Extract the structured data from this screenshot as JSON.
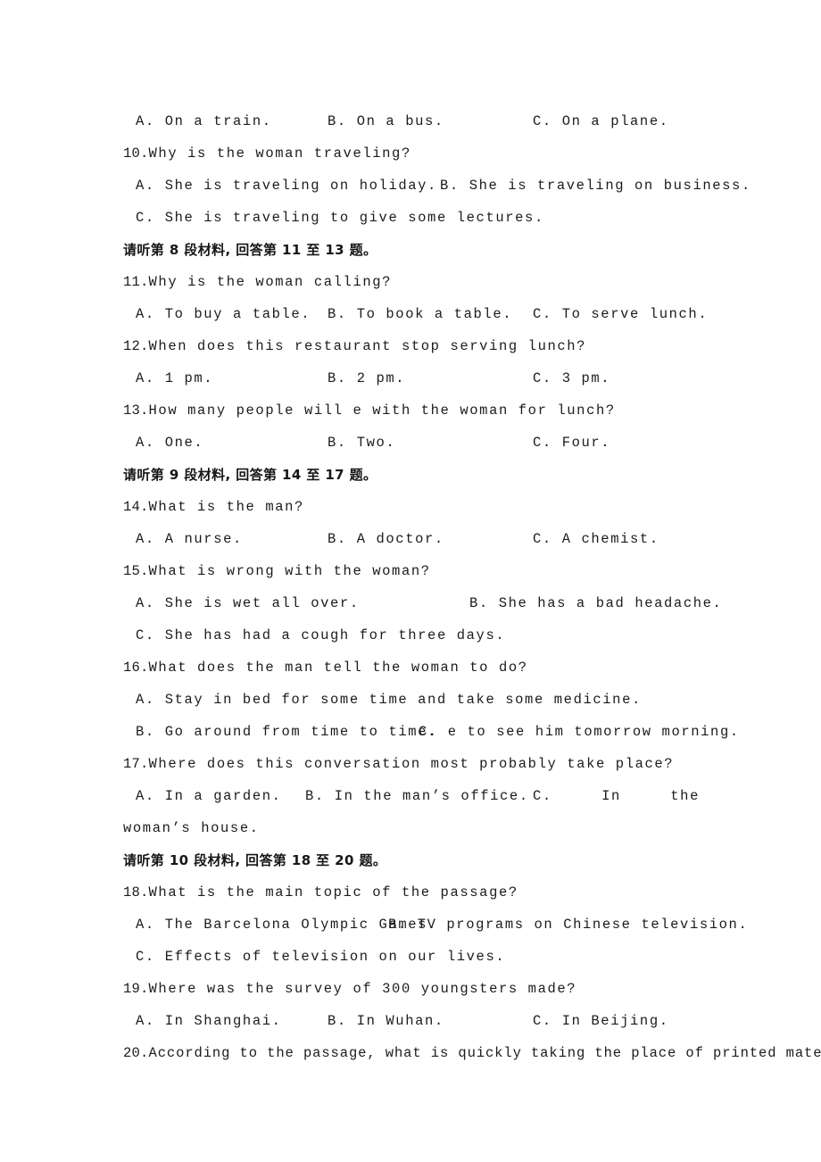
{
  "document": {
    "type": "english-listening-comprehension-exam-page",
    "language_mix": "english-with-chinese-section-headers"
  },
  "lines": {
    "q9_options": {
      "a": "A. On a train.",
      "b": "B. On a bus.",
      "c": "C. On a plane."
    },
    "q10": {
      "num": "10.",
      "stem": "Why is the woman traveling?",
      "a": "A. She is traveling on holiday.",
      "b": "B. She is traveling on business.",
      "c": "C. She is traveling to give some lectures."
    },
    "header_8": "请听第 8 段材料, 回答第 11 至 13 题。",
    "q11": {
      "num": "11.",
      "stem": "Why is the woman calling?",
      "a": "A. To buy a table.",
      "b": "B. To book a table.",
      "c": "C. To serve lunch."
    },
    "q12": {
      "num": "12.",
      "stem": "When does this restaurant stop serving lunch?",
      "a": "A. 1 pm.",
      "b": "B. 2 pm.",
      "c": "C. 3 pm."
    },
    "q13": {
      "num": "13.",
      "stem": "How many people will e with the woman for lunch?",
      "a": "A. One.",
      "b": "B. Two.",
      "c": "C. Four."
    },
    "header_9": "请听第 9 段材料, 回答第 14 至 17 题。",
    "q14": {
      "num": "14.",
      "stem": "What is the man?",
      "a": "A. A nurse.",
      "b": "B. A doctor.",
      "c": "C. A chemist."
    },
    "q15": {
      "num": "15.",
      "stem": "What is wrong with the woman?",
      "a": "A. She is wet all over.",
      "b": "B. She has a bad headache.",
      "c": "C. She has had a cough for three days."
    },
    "q16": {
      "num": "16.",
      "stem": "What does the man tell the woman to do?",
      "a": "A. Stay in bed for some time and take some medicine.",
      "b": "B. Go around from time to time.",
      "c": "C. e to see him tomorrow morning."
    },
    "q17": {
      "num": "17.",
      "stem": "Where does this conversation most probably take place?",
      "a": "A. In a garden.",
      "b": "B. In the man’s office.",
      "c_part1": "C.",
      "c_part2": "In",
      "c_part3": "the",
      "c_wrap": "woman’s house."
    },
    "header_10": "请听第 10 段材料, 回答第 18 至 20 题。",
    "q18": {
      "num": "18.",
      "stem": "What is the main topic of the passage?",
      "a": "A. The Barcelona Olympic Games.",
      "b": "B. TV programs on Chinese television.",
      "c": "C. Effects of television on our lives."
    },
    "q19": {
      "num": "19.",
      "stem": "Where was the survey of 300 youngsters made?",
      "a": "A. In Shanghai.",
      "b": "B. In Wuhan.",
      "c": "C. In Beijing."
    },
    "q20": {
      "num": "20.",
      "stem": "According to the passage, what is quickly taking the place of printed material"
    }
  }
}
